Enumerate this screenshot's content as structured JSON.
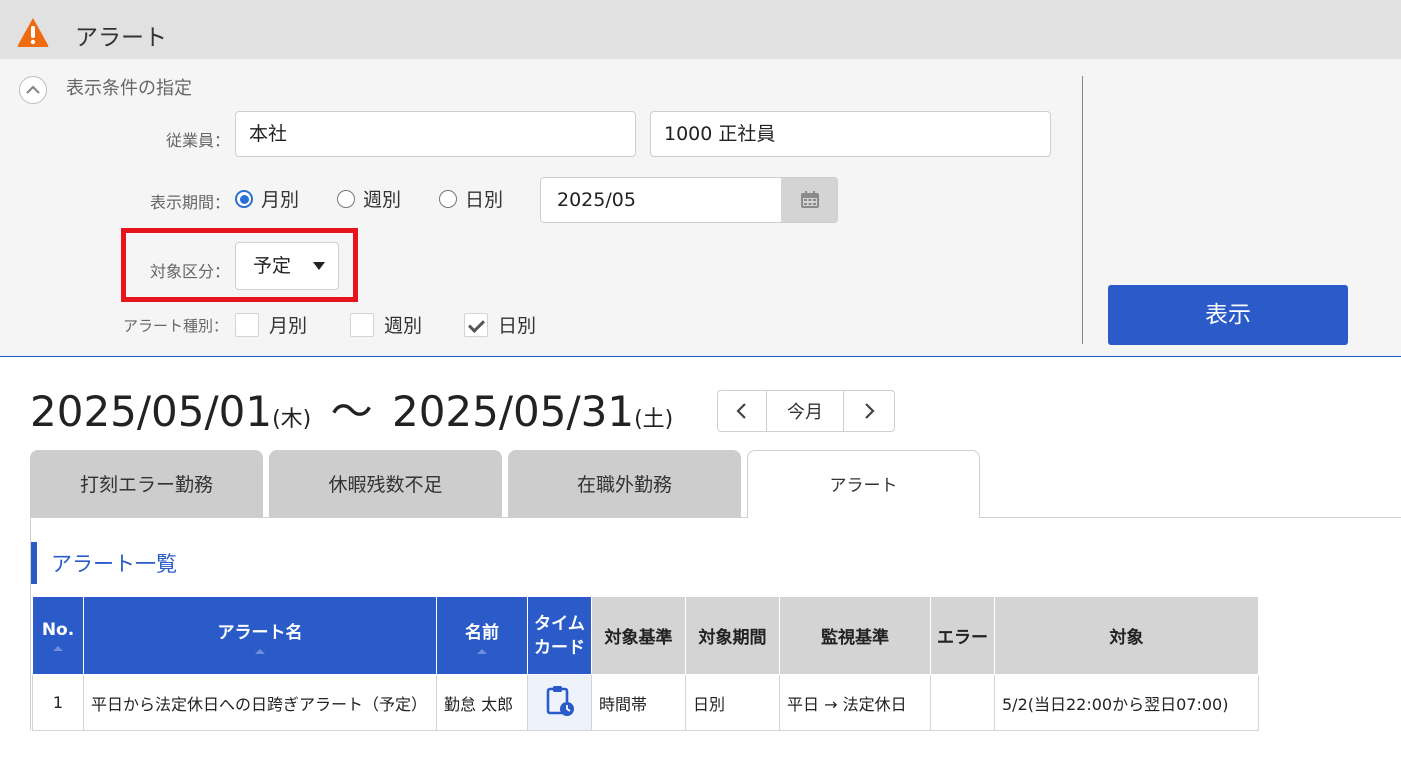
{
  "header": {
    "title": "アラート",
    "icon": "warning-icon",
    "icon_color": "#f06a10"
  },
  "conditions": {
    "title": "表示条件の指定",
    "employee_label": "従業員：",
    "company_value": "本社",
    "employment_value": "1000 正社員",
    "period_label": "表示期間：",
    "period_options": [
      "月別",
      "週別",
      "日別"
    ],
    "period_selected": "月別",
    "date_value": "2025/05",
    "target_label": "対象区分：",
    "target_value": "予定",
    "alert_type_label": "アラート種別：",
    "alert_types": [
      {
        "label": "月別",
        "checked": false
      },
      {
        "label": "週別",
        "checked": false
      },
      {
        "label": "日別",
        "checked": true
      }
    ],
    "show_button": "表示",
    "highlight_color": "#e8141b"
  },
  "range": {
    "start": "2025/05/01",
    "start_dow": "(木)",
    "tilde": "〜",
    "end": "2025/05/31",
    "end_dow": "(土)"
  },
  "pager": {
    "current": "今月"
  },
  "tabs": [
    {
      "label": "打刻エラー勤務",
      "active": false
    },
    {
      "label": "休暇残数不足",
      "active": false
    },
    {
      "label": "在職外勤務",
      "active": false
    },
    {
      "label": "アラート",
      "active": true
    }
  ],
  "section_title": "アラート一覧",
  "table": {
    "headers": [
      "No.",
      "アラート名",
      "名前",
      "タイム\nカード",
      "対象基準",
      "対象期間",
      "監視基準",
      "エラー",
      "対象"
    ],
    "rows": [
      {
        "no": "1",
        "alert_name": "平日から法定休日への日跨ぎアラート（予定）",
        "name": "勤怠 太郎",
        "timecard_icon": "timecard-icon",
        "basis": "時間帯",
        "period": "日別",
        "monitor": "平日 → 法定休日",
        "error": "",
        "target": "5/2(当日22:00から翌日07:00)"
      }
    ]
  },
  "colors": {
    "accent": "#2a5bc8",
    "header_bg": "#e1e1e1"
  }
}
